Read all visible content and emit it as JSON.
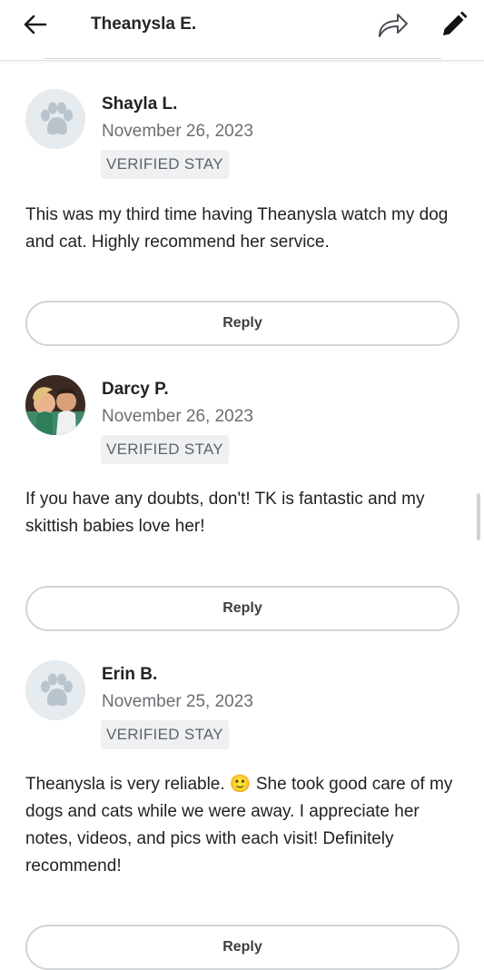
{
  "header": {
    "title": "Theanysla E."
  },
  "reviews": [
    {
      "name": "Shayla L.",
      "date": "November 26, 2023",
      "badge": "VERIFIED STAY",
      "avatar": "paw-placeholder",
      "text": "This was my third time having Theanysla watch my dog and cat. Highly recommend her service.",
      "reply_label": "Reply"
    },
    {
      "name": "Darcy P.",
      "date": "November 26, 2023",
      "badge": "VERIFIED STAY",
      "avatar": "user-photo",
      "text": "If you have any doubts, don't! TK is fantastic and my skittish babies love her!",
      "reply_label": "Reply"
    },
    {
      "name": "Erin B.",
      "date": "November 25, 2023",
      "badge": "VERIFIED STAY",
      "avatar": "paw-placeholder",
      "text": "Theanysla is very reliable. 🙂 She took good care of my dogs and cats while we were away. I appreciate her notes, videos, and pics with each visit! Definitely recommend!",
      "reply_label": "Reply"
    }
  ],
  "icons": {
    "back": "arrow-left-icon",
    "share": "share-arrow-icon",
    "edit": "pencil-icon",
    "avatar_placeholder": "paw-icon"
  },
  "colors": {
    "badge_bg": "#eef0f2",
    "reply_border": "#cfd4d8",
    "avatar_bg": "#e6ebef",
    "paw": "#b9c4cd"
  }
}
